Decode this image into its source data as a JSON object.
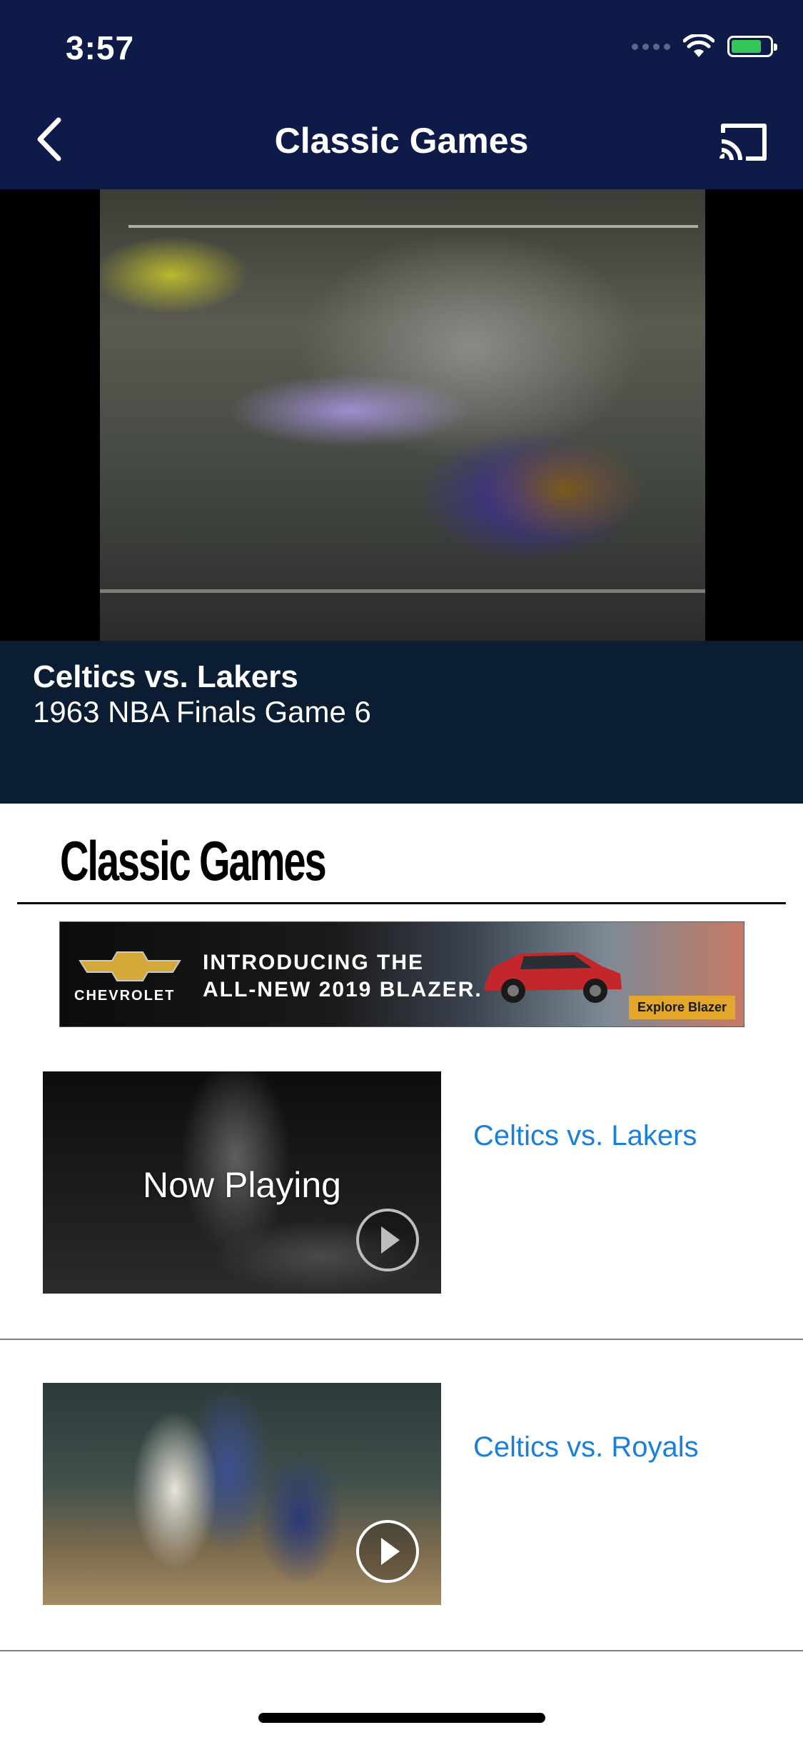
{
  "status_bar": {
    "time": "3:57",
    "icons": [
      "signal-icon",
      "wifi-icon",
      "battery-icon"
    ],
    "battery_color": "#33c759"
  },
  "nav": {
    "title": "Classic Games",
    "back_icon": "chevron-left-icon",
    "cast_icon": "cast-icon",
    "background": "#0e1a47"
  },
  "now_playing": {
    "title": "Celtics vs. Lakers",
    "subtitle": "1963 NBA Finals Game 6"
  },
  "section": {
    "title": "Classic Games"
  },
  "ad": {
    "brand": "CHEVROLET",
    "headline_line1": "INTRODUCING THE",
    "headline_line2": "ALL-NEW 2019 BLAZER.",
    "cta": "Explore Blazer"
  },
  "games": [
    {
      "title": "Celtics vs. Lakers",
      "overlay": "Now Playing"
    },
    {
      "title": "Celtics vs. Royals",
      "overlay": ""
    }
  ],
  "colors": {
    "accent_link": "#1a7fd6",
    "info_panel": "#0b1d33"
  }
}
